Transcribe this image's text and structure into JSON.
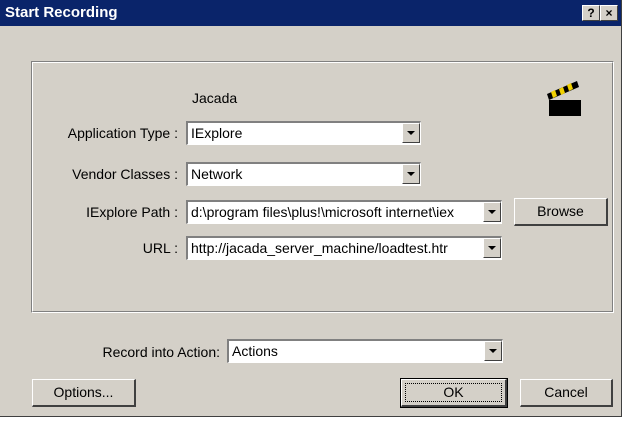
{
  "window": {
    "title": "Start Recording",
    "help_label": "?",
    "close_label": "×"
  },
  "group": {
    "heading": "Jacada",
    "icon": "clapperboard-icon"
  },
  "fields": {
    "application_type": {
      "label": "Application Type :",
      "value": "IExplore"
    },
    "vendor_classes": {
      "label": "Vendor Classes :",
      "value": "Network"
    },
    "iexplore_path": {
      "label": "IExplore Path :",
      "value": "d:\\program files\\plus!\\microsoft internet\\iex"
    },
    "url": {
      "label": "URL :",
      "value": "http://jacada_server_machine/loadtest.htr"
    },
    "record_into_action": {
      "label": "Record into Action:",
      "value": "Actions"
    }
  },
  "buttons": {
    "browse": "Browse",
    "options": "Options...",
    "ok": "OK",
    "cancel": "Cancel"
  }
}
